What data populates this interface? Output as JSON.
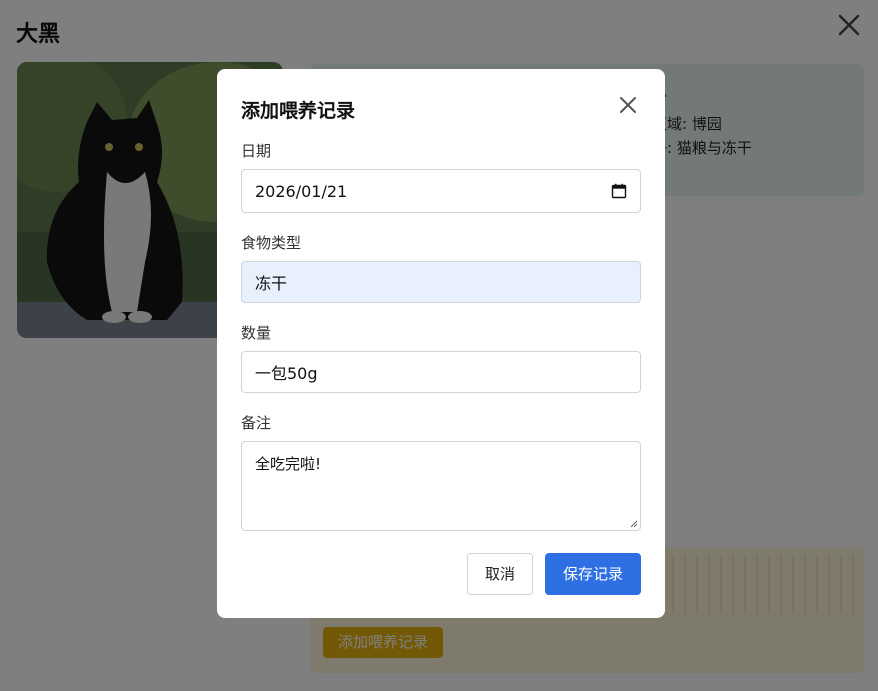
{
  "page": {
    "title": "大黑",
    "info_title": "息",
    "info_lines": [
      "区域: 博园",
      "子: 猫粮与冻干"
    ],
    "add_feeding_button": "添加喂养记录"
  },
  "modal": {
    "title": "添加喂养记录",
    "fields": {
      "date": {
        "label": "日期",
        "value": "2026/01/21"
      },
      "food_type": {
        "label": "食物类型",
        "value": "冻干"
      },
      "amount": {
        "label": "数量",
        "value": "一包50g"
      },
      "notes": {
        "label": "备注",
        "value": "全吃完啦!"
      }
    },
    "buttons": {
      "cancel": "取消",
      "save": "保存记录"
    }
  },
  "colors": {
    "accent": "#2f6fe4",
    "feed_button": "#e7b10a",
    "info_card": "#e6f5ea",
    "autofill": "#e8f0fe"
  },
  "icons": [
    "close-icon",
    "calendar-icon",
    "resize-handle-icon"
  ]
}
